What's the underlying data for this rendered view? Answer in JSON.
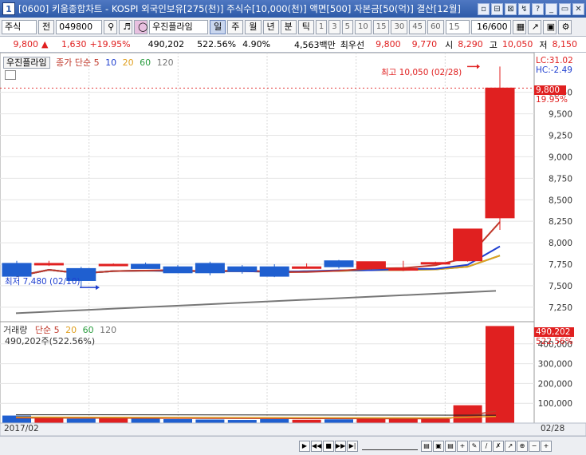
{
  "window": {
    "number": "1",
    "title": "[0600] 키움종합차트 - KOSPI 외국인보유[275(천)] 주식수[10,000(천)] 액면[500] 자본금[50(억)] 결산[12월]",
    "buttons": [
      "▫",
      "⊟",
      "⊠",
      "↯",
      "?",
      "_",
      "▭",
      "✕"
    ]
  },
  "toolbar": {
    "category": "주식",
    "prefix": "전",
    "code": "049800",
    "stock_name": "우진플라임",
    "periods": [
      "일",
      "주",
      "월",
      "년",
      "분",
      "틱"
    ],
    "active_period": "일",
    "minute_options": [
      "1",
      "3",
      "5",
      "10",
      "15",
      "30",
      "45",
      "60"
    ],
    "count_select": "15",
    "page_counter": "16/600"
  },
  "quote": {
    "price": "9,800",
    "change_arrow": "▲",
    "change": "1,630",
    "change_pct": "+19.95%",
    "volume": "490,202",
    "volume_pct": "522.56%",
    "ratio": "4.90%",
    "amount": "4,563백만",
    "bid_label": "최우선",
    "bid": "9,800",
    "ask": "9,770",
    "open_label": "시",
    "open": "8,290",
    "high_label": "고",
    "high": "10,050",
    "low_label": "저",
    "low": "8,150"
  },
  "price_panel": {
    "stock_label": "우진플라임",
    "ma_label": "종가 단순",
    "ma_periods": [
      "5",
      "10",
      "20",
      "60",
      "120"
    ],
    "ma_colors": [
      "#c0392b",
      "#1f3fd0",
      "#e0a020",
      "#2a9d3f",
      "#777777"
    ],
    "max_label": "최고 10,050 (02/28)",
    "min_label": "최저 7,480 (02/10)",
    "lc": "LC:31.02",
    "hc": "HC:-2.49",
    "last_price": "9,800",
    "last_pct": "19.95%",
    "y_ticks": [
      "9,750",
      "9,500",
      "9,250",
      "9,000",
      "8,750",
      "8,500",
      "8,250",
      "8,000",
      "7,750",
      "7,500",
      "7,250"
    ]
  },
  "volume_panel": {
    "label": "거래량",
    "ma_label": "단순",
    "ma_periods": [
      "5",
      "20",
      "60",
      "120"
    ],
    "ma_colors": [
      "#c0392b",
      "#e0a020",
      "#2a9d3f",
      "#777777"
    ],
    "last_volume": "490,202주(522.56%)",
    "last_value": "490,202",
    "last_pct": "522.56%",
    "y_ticks": [
      "400,000",
      "300,000",
      "200,000",
      "100,000"
    ]
  },
  "xaxis": {
    "start": "2017/02",
    "end": "02/28"
  },
  "chart_data": {
    "type": "candlestick",
    "series": [
      {
        "name": "candles",
        "ohlc": [
          [
            7760,
            7790,
            7600,
            7610
          ],
          [
            7760,
            7790,
            7730,
            7760
          ],
          [
            7700,
            7720,
            7480,
            7560
          ],
          [
            7750,
            7760,
            7740,
            7750
          ],
          [
            7750,
            7770,
            7700,
            7700
          ],
          [
            7720,
            7740,
            7650,
            7650
          ],
          [
            7760,
            7780,
            7620,
            7650
          ],
          [
            7720,
            7740,
            7640,
            7670
          ],
          [
            7720,
            7750,
            7600,
            7610
          ],
          [
            7720,
            7760,
            7700,
            7720
          ],
          [
            7790,
            7800,
            7700,
            7720
          ],
          [
            7700,
            7780,
            7690,
            7780
          ],
          [
            7680,
            7790,
            7670,
            7700
          ],
          [
            7770,
            7780,
            7760,
            7770
          ],
          [
            7790,
            8160,
            7780,
            8160
          ],
          [
            8290,
            10050,
            8150,
            9800
          ]
        ]
      },
      {
        "name": "volume",
        "values": [
          38000,
          30000,
          22000,
          26000,
          24000,
          20000,
          18000,
          16000,
          20000,
          17000,
          19000,
          22000,
          24000,
          21000,
          90000,
          490202
        ]
      }
    ],
    "ylim": [
      7100,
      10100
    ],
    "volume_ylim": [
      0,
      500000
    ]
  }
}
